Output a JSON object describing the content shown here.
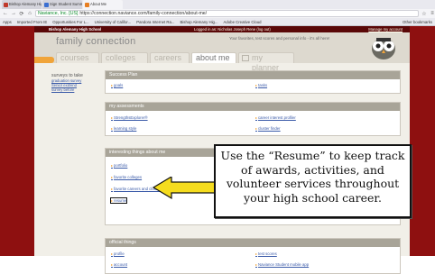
{
  "browser": {
    "tabs": [
      {
        "label": "Bishop Alemany High S...",
        "color": "#c0392b"
      },
      {
        "label": "Sign Student Summary...",
        "color": "#3b6fd1"
      },
      {
        "label": "About Me",
        "color": "#e67e22"
      }
    ],
    "secure_label": "Naviance, Inc. [US]",
    "url": "https://connection.naviance.com/family-connection/about-me/",
    "bookmarks": [
      {
        "label": "Apps"
      },
      {
        "label": "Imported From IE"
      },
      {
        "label": "Opportunities For L..."
      },
      {
        "label": "University of Califor..."
      },
      {
        "label": "Pandora Internet Ra..."
      },
      {
        "label": "Bishop Alemany Hig..."
      },
      {
        "label": "Adobe Creative Cloud"
      },
      {
        "label": "Other bookmarks"
      }
    ]
  },
  "banner": {
    "school": "Bishop Alemany High School",
    "logged_in": "Logged in as: Nicholas Joseph Rene (log out)",
    "manage": "Manage my account"
  },
  "header": {
    "brand": "family connection",
    "tagline": "Your favorites, test scores and personal info - it's all here!",
    "tabs": [
      "courses",
      "colleges",
      "careers",
      "about me",
      "my planner"
    ]
  },
  "sidebar": {
    "title": "surveys to take",
    "links": [
      "graduation survey",
      "Senior exit/end",
      "survey before"
    ]
  },
  "panels": {
    "success": {
      "title": "Success Plan",
      "items": [
        "goals",
        "tasks"
      ]
    },
    "assessments": {
      "title": "my assessments",
      "items": [
        "StrengthsExplorer®",
        "career interest profiler",
        "learning style",
        "cluster finder"
      ]
    },
    "interesting": {
      "title": "interesting things about me",
      "items": [
        "portfolio",
        "favorite colleges",
        "favorite careers and clusters",
        "resume"
      ]
    },
    "official": {
      "title": "official things",
      "items": [
        "profile",
        "test scores",
        "account",
        "Naviance Student mobile app"
      ]
    }
  },
  "callout": {
    "text": "Use the “Resume” to keep track of awards, activities, and volunteer services throughout your high school career."
  }
}
